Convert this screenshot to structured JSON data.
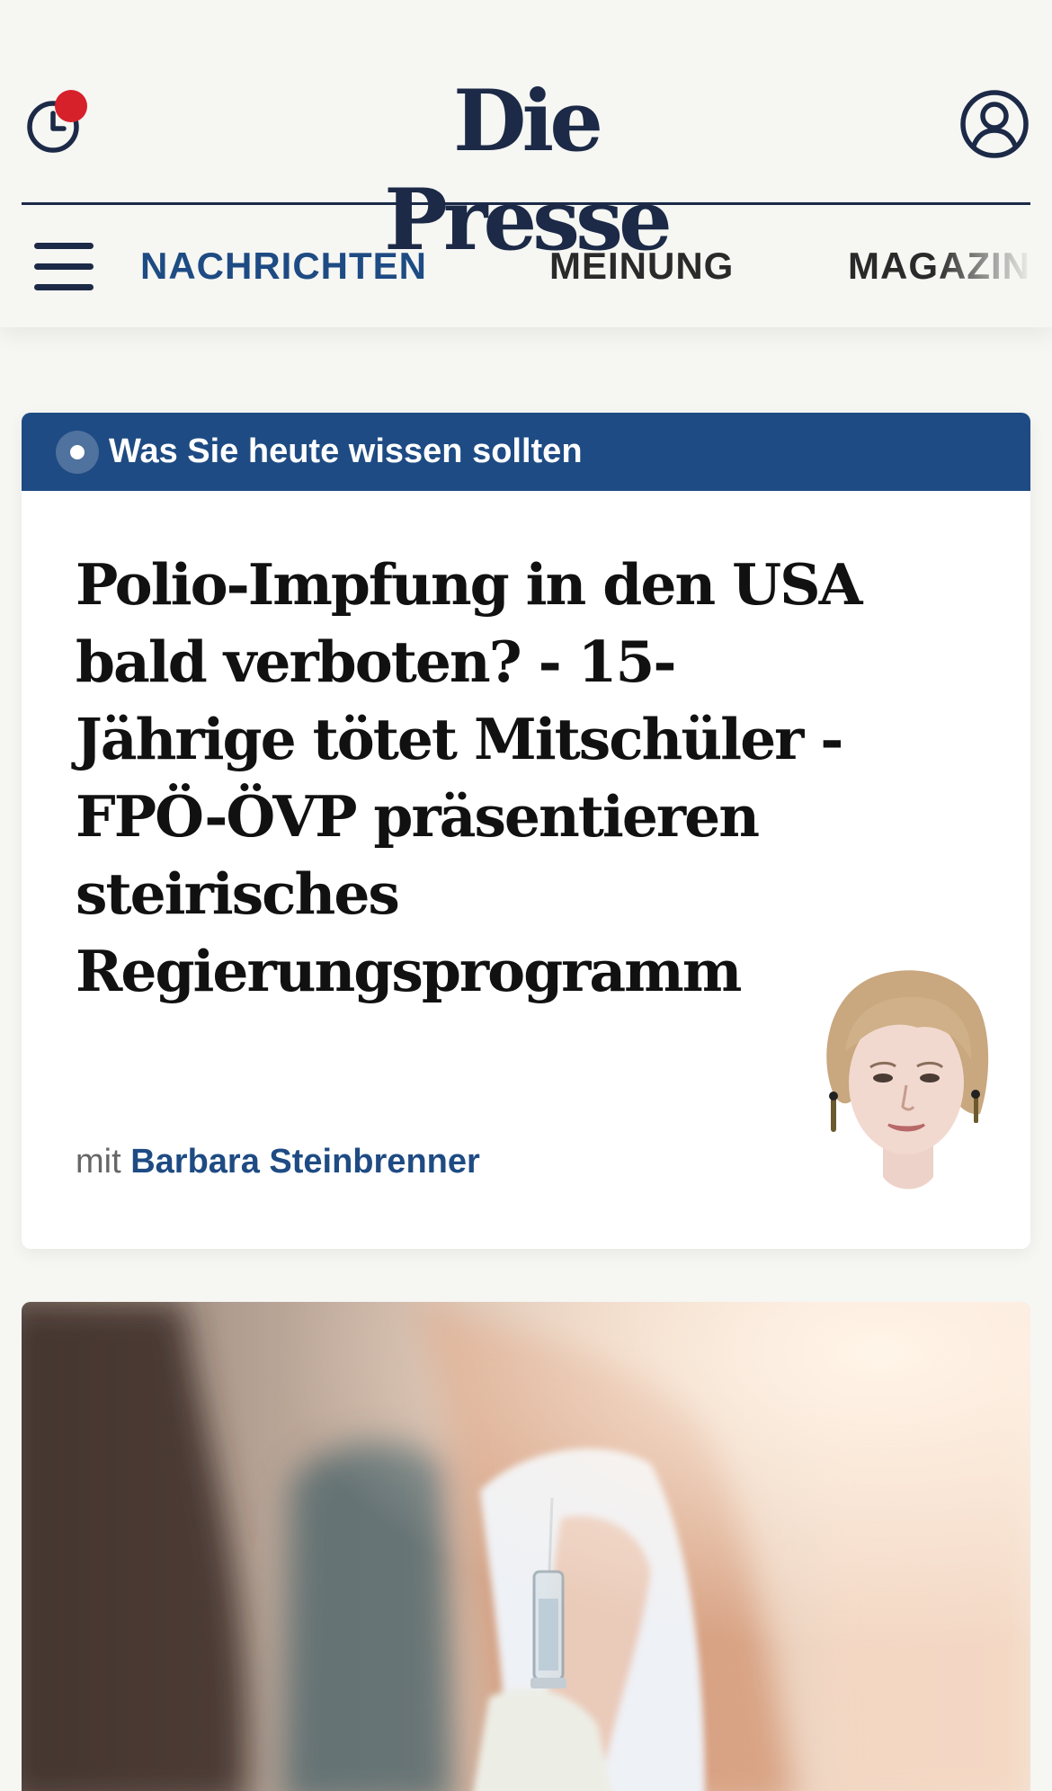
{
  "header": {
    "logo": "Die Presse",
    "history_icon": "clock-history-icon",
    "account_icon": "user-account-icon",
    "menu_icon": "hamburger-menu-icon",
    "notification_color": "#d6202a",
    "brand_color": "#1c2a47",
    "accent_color": "#1e4b83"
  },
  "nav": {
    "items": [
      {
        "label": "NACHRICHTEN",
        "active": true
      },
      {
        "label": "MEINUNG",
        "active": false
      },
      {
        "label": "MAGAZIN",
        "active": false
      }
    ]
  },
  "briefing": {
    "label": "Was Sie heute wissen sollten",
    "headline": "Polio-Impfung in den USA bald verboten? - 15-Jährige tötet Mitschüler - FPÖ-ÖVP präsentieren steirisches Regierungsprogramm",
    "byline_prefix": "mit",
    "author": "Barbara Steinbrenner"
  }
}
